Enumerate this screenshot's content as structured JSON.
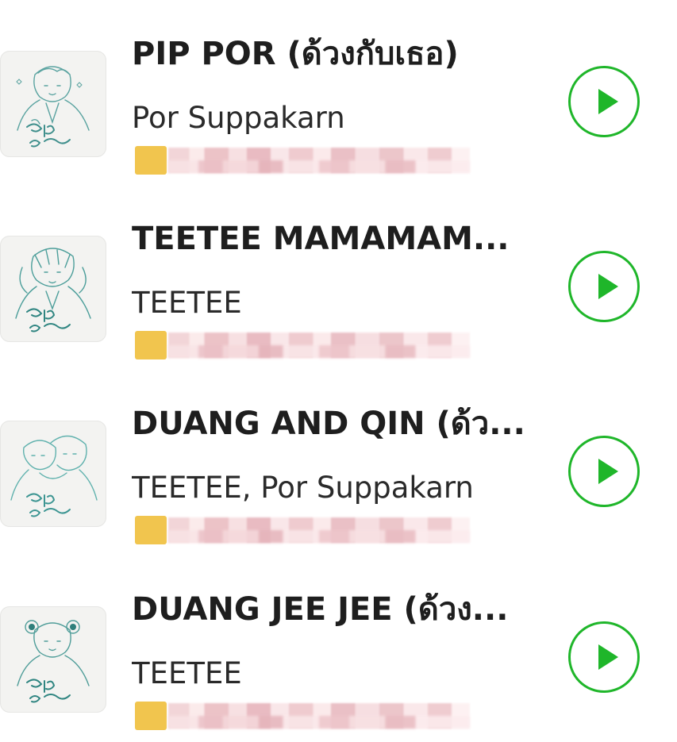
{
  "accent_color": "#1fb62a",
  "tracks": [
    {
      "title": "PIP POR (ด้วงกับเธอ)",
      "artist": "Por Suppakarn",
      "play_icon": "play-icon",
      "cover_icon": "album-cover"
    },
    {
      "title": "TEETEE MAMAMAM...",
      "artist": "TEETEE",
      "play_icon": "play-icon",
      "cover_icon": "album-cover"
    },
    {
      "title": "DUANG AND QIN (ด้ว...",
      "artist": "TEETEE, Por Suppakarn",
      "play_icon": "play-icon",
      "cover_icon": "album-cover"
    },
    {
      "title": "DUANG JEE JEE (ด้วง...",
      "artist": "TEETEE",
      "play_icon": "play-icon",
      "cover_icon": "album-cover"
    }
  ]
}
